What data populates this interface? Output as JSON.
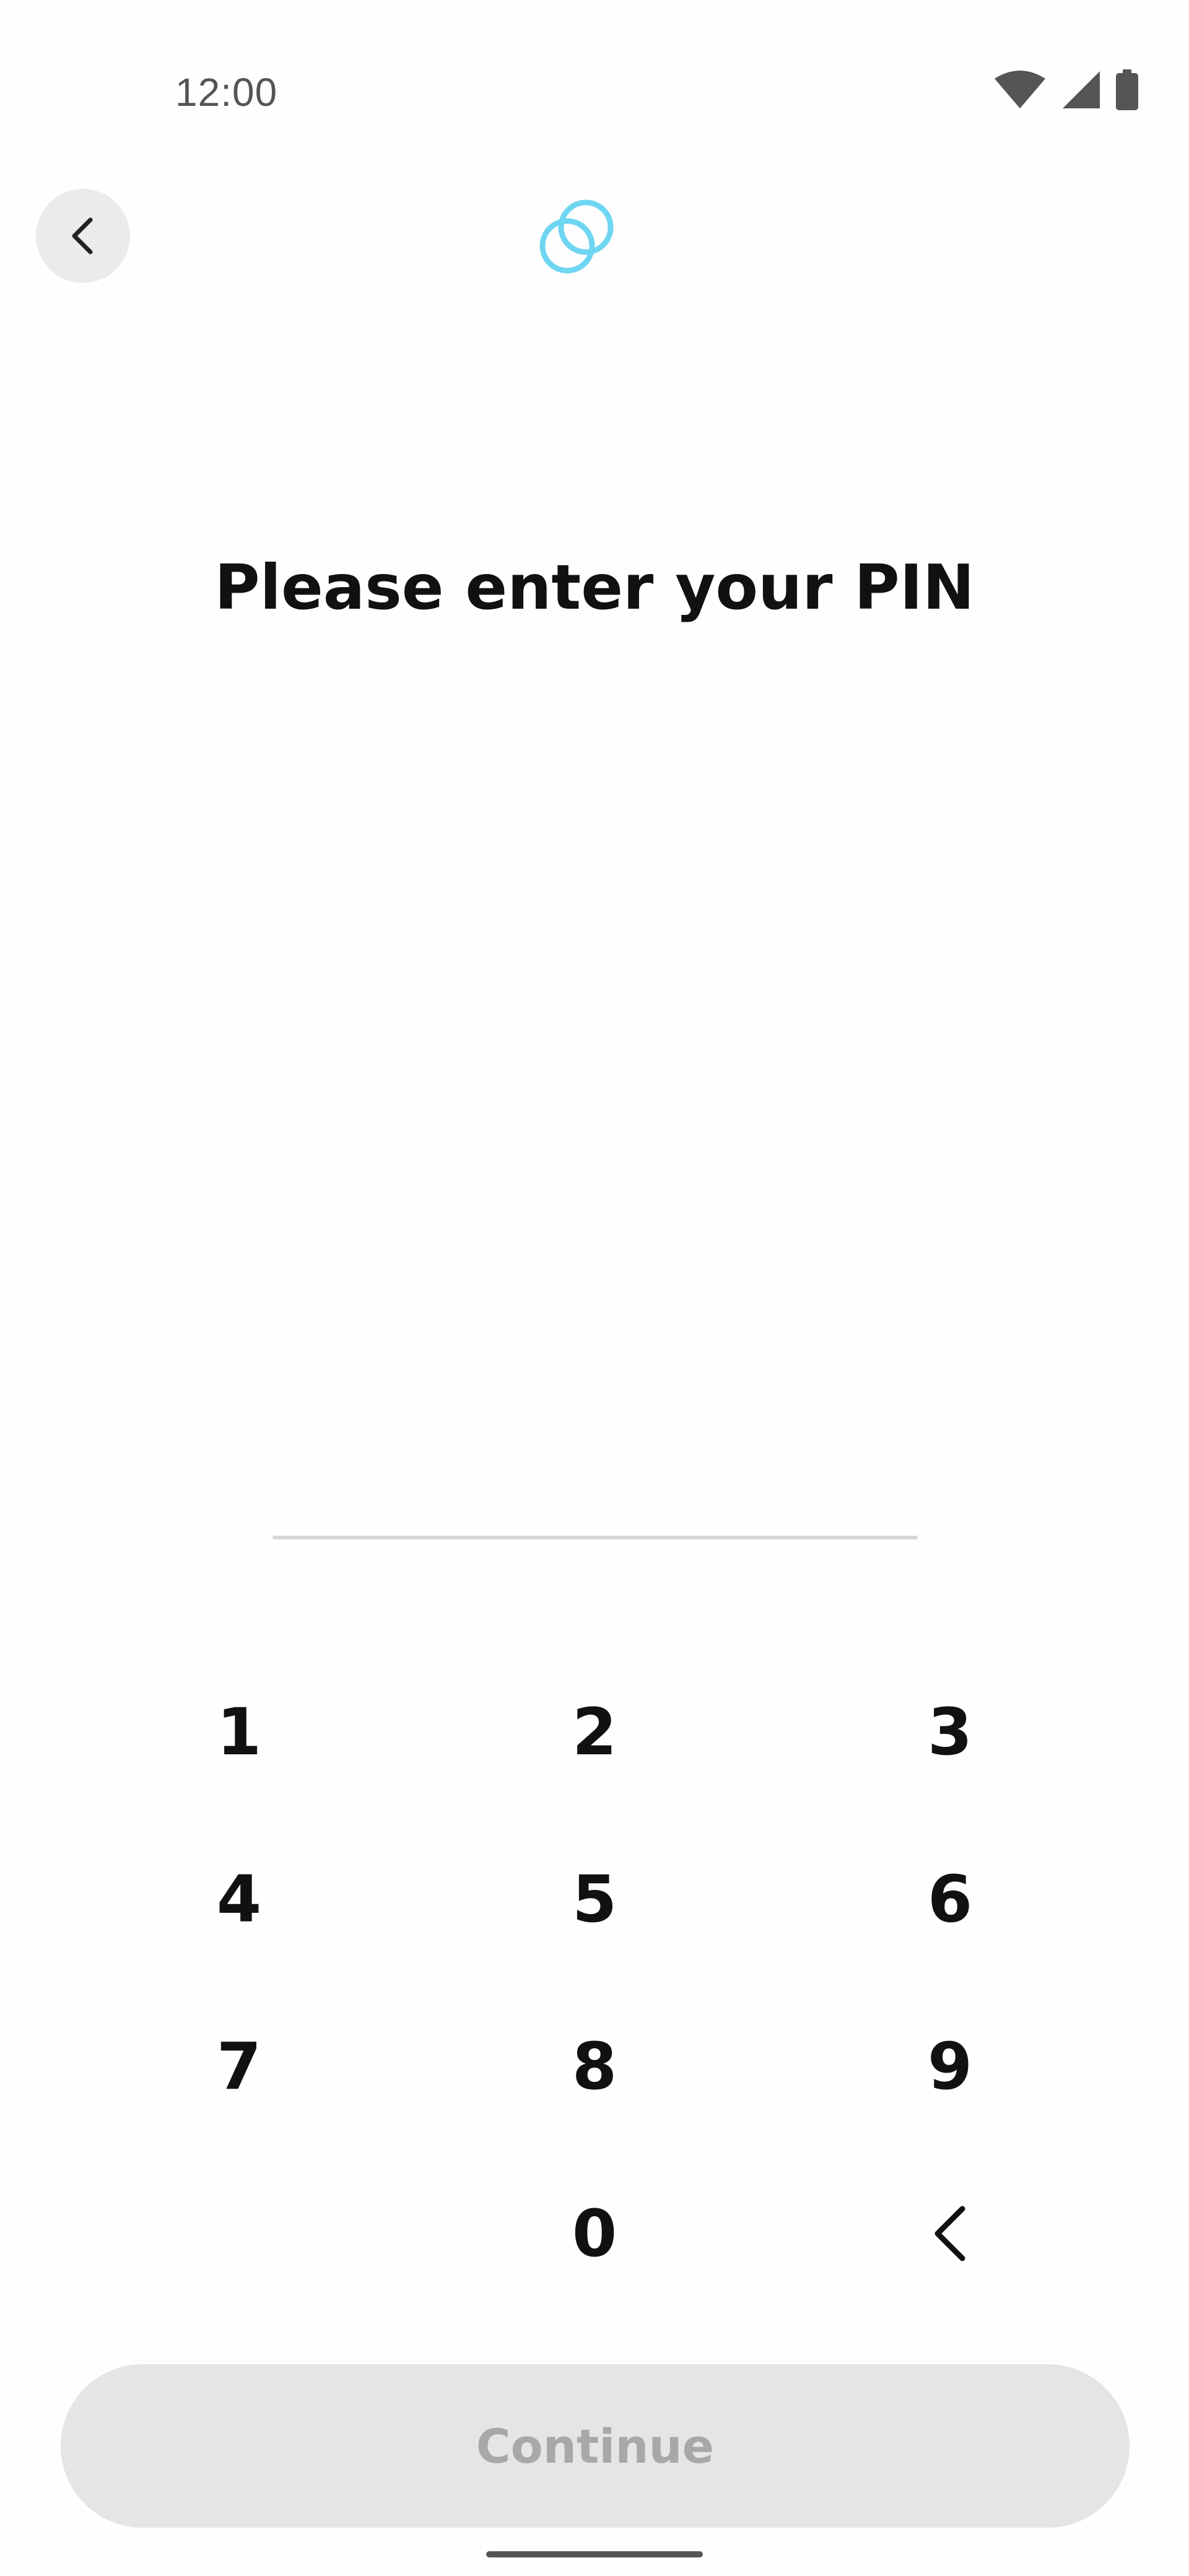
{
  "status_bar": {
    "time": "12:00",
    "icons": [
      "wifi-icon",
      "cell-signal-icon",
      "battery-icon"
    ]
  },
  "header": {
    "back_icon": "chevron-left-icon",
    "logo_icon": "gemini-logo-icon",
    "logo_color": "#6fd6f2"
  },
  "title": "Please enter your PIN",
  "keypad": {
    "keys": [
      "1",
      "2",
      "3",
      "4",
      "5",
      "6",
      "7",
      "8",
      "9",
      "0"
    ],
    "backspace_icon": "backspace-chevron-icon"
  },
  "continue_button": {
    "label": "Continue",
    "enabled": false
  }
}
